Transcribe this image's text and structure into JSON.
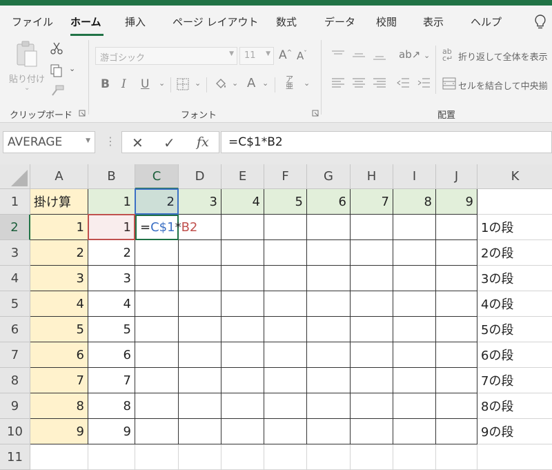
{
  "ribbon_tabs": [
    "ファイル",
    "ホーム",
    "挿入",
    "ページ レイアウト",
    "数式",
    "データ",
    "校閲",
    "表示",
    "ヘルプ"
  ],
  "active_tab": "ホーム",
  "clipboard": {
    "paste_label": "貼り付け",
    "group_label": "クリップボード"
  },
  "font": {
    "font_name": "游ゴシック",
    "font_size": "11",
    "grow": "A",
    "shrink": "A",
    "bold": "B",
    "italic": "I",
    "underline": "U",
    "font_color": "A",
    "group_label": "フォント"
  },
  "alignment": {
    "wrap_text": "折り返して全体を表示",
    "merge_center": "セルを結合して中央揃",
    "group_label": "配置"
  },
  "formula_bar": {
    "name_box": "AVERAGE",
    "cancel": "✕",
    "enter": "✓",
    "fx": "fx",
    "formula": "=C$1*B2"
  },
  "columns": [
    "A",
    "B",
    "C",
    "D",
    "E",
    "F",
    "G",
    "H",
    "I",
    "J",
    "K"
  ],
  "rows": [
    "1",
    "2",
    "3",
    "4",
    "5",
    "6",
    "7",
    "8",
    "9",
    "10",
    "11"
  ],
  "cells": {
    "A1": "掛け算",
    "B1": "1",
    "C1": "2",
    "D1": "3",
    "E1": "4",
    "F1": "5",
    "G1": "6",
    "H1": "7",
    "I1": "8",
    "J1": "9",
    "A2": "1",
    "A3": "2",
    "A4": "3",
    "A5": "4",
    "A6": "5",
    "A7": "6",
    "A8": "7",
    "A9": "8",
    "A10": "9",
    "B2": "1",
    "B3": "2",
    "B4": "3",
    "B5": "4",
    "B6": "5",
    "B7": "6",
    "B8": "7",
    "B9": "8",
    "B10": "9",
    "K2": "1の段",
    "K3": "2の段",
    "K4": "3の段",
    "K5": "4の段",
    "K6": "5の段",
    "K7": "6の段",
    "K8": "7の段",
    "K9": "8の段",
    "K10": "9の段"
  },
  "edit_cell": {
    "address": "C2",
    "eq": "=",
    "ref1": "C$1",
    "op": "*",
    "ref2": "B2"
  },
  "colors": {
    "excel_green": "#217346",
    "header_fill_yellow": "#fff2cc",
    "header_fill_green": "#e2efda",
    "ref_blue": "#3a6fc4",
    "ref_red": "#c0504d"
  }
}
